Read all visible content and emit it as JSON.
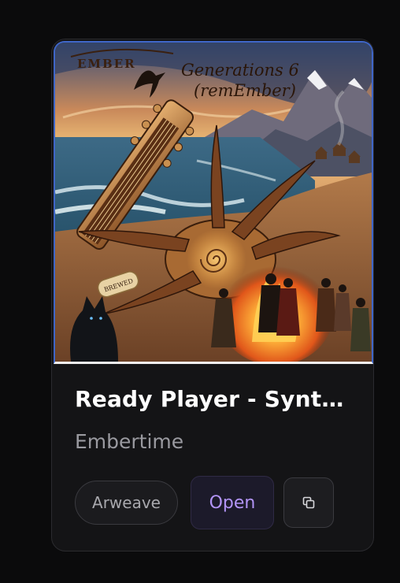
{
  "card": {
    "artwork": {
      "overlay_title_line1": "Generations 6",
      "overlay_title_line2": "(remEmber)",
      "brand_mark": "EMBER",
      "scroll_label": "BREWED"
    },
    "title": "Ready Player - Syntr…",
    "artist": "Embertime",
    "storage_tag": "Arweave",
    "open_label": "Open",
    "copy_icon": "copy-icon"
  },
  "colors": {
    "card_background": "#141416",
    "open_text": "#b294f6",
    "artwork_border": "#3f66c8"
  }
}
